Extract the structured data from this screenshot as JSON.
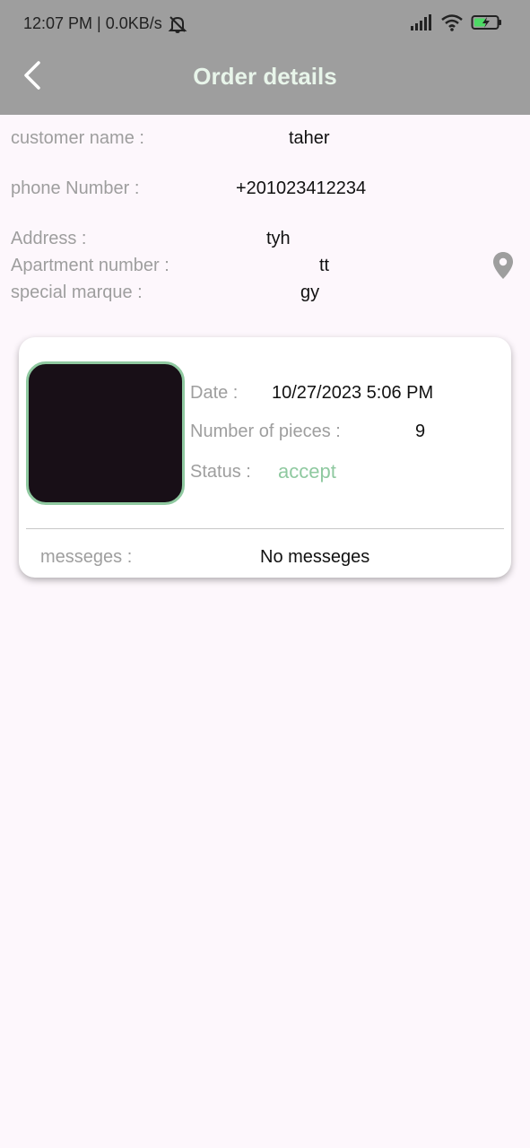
{
  "status_bar": {
    "time_speed": "12:07 PM | 0.0KB/s"
  },
  "header": {
    "title": "Order details"
  },
  "customer": {
    "name_label": "customer name :",
    "name_value": "taher",
    "phone_label": "phone Number :",
    "phone_value": "+201023412234",
    "address_label": "Address :",
    "address_value": "tyh",
    "apartment_label": "Apartment number :",
    "apartment_value": "tt",
    "marque_label": "special marque :",
    "marque_value": "gy"
  },
  "order_card": {
    "date_label": "Date :",
    "date_value": "10/27/2023 5:06 PM",
    "pieces_label": "Number of pieces :",
    "pieces_value": "9",
    "status_label": "Status :",
    "status_value": "accept",
    "messages_label": "messeges :",
    "messages_value": "No messeges"
  },
  "icons": {
    "back": "chevron-left-icon",
    "location": "map-pin-icon",
    "bell": "bell-off-icon",
    "signal": "signal-icon",
    "wifi": "wifi-icon",
    "battery": "battery-charging-icon"
  },
  "colors": {
    "app_bar": "#9e9e9e",
    "title": "#e8f5ea",
    "accent_green": "#8fc9a0",
    "background": "#fdf7fc",
    "label_gray": "#9e9e9e"
  }
}
